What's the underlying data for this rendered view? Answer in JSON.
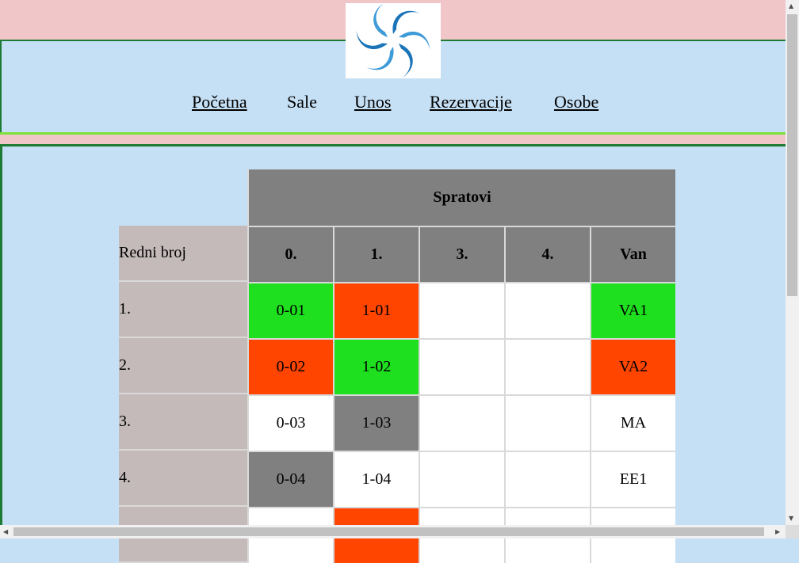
{
  "logo": {
    "icon": "spiral-logo-icon",
    "colors": [
      "#1b74b8",
      "#5ab3e6"
    ]
  },
  "nav": {
    "items": [
      {
        "label": "Početna",
        "link": true
      },
      {
        "label": "Sale",
        "link": false
      },
      {
        "label": "Unos",
        "link": true
      },
      {
        "label": "Rezervacije",
        "link": true
      },
      {
        "label": "Osobe",
        "link": true
      }
    ]
  },
  "table": {
    "group_header": "Spratovi",
    "row_label_header": "Redni broj",
    "columns": [
      "0.",
      "1.",
      "3.",
      "4.",
      "Van"
    ],
    "rows": [
      {
        "number": "1.",
        "cells": [
          {
            "text": "0-01",
            "status": "green"
          },
          {
            "text": "1-01",
            "status": "red"
          },
          {
            "text": "",
            "status": "white"
          },
          {
            "text": "",
            "status": "white"
          },
          {
            "text": "VA1",
            "status": "green"
          }
        ]
      },
      {
        "number": "2.",
        "cells": [
          {
            "text": "0-02",
            "status": "red"
          },
          {
            "text": "1-02",
            "status": "green"
          },
          {
            "text": "",
            "status": "white"
          },
          {
            "text": "",
            "status": "white"
          },
          {
            "text": "VA2",
            "status": "red"
          }
        ]
      },
      {
        "number": "3.",
        "cells": [
          {
            "text": "0-03",
            "status": "white"
          },
          {
            "text": "1-03",
            "status": "gray"
          },
          {
            "text": "",
            "status": "white"
          },
          {
            "text": "",
            "status": "white"
          },
          {
            "text": "MA",
            "status": "white"
          }
        ]
      },
      {
        "number": "4.",
        "cells": [
          {
            "text": "0-04",
            "status": "gray"
          },
          {
            "text": "1-04",
            "status": "white"
          },
          {
            "text": "",
            "status": "white"
          },
          {
            "text": "",
            "status": "white"
          },
          {
            "text": "EE1",
            "status": "white"
          }
        ]
      },
      {
        "number": "",
        "cells": [
          {
            "text": "",
            "status": "white"
          },
          {
            "text": "",
            "status": "red"
          },
          {
            "text": "",
            "status": "white"
          },
          {
            "text": "",
            "status": "white"
          },
          {
            "text": "",
            "status": "white"
          }
        ]
      }
    ]
  },
  "colors": {
    "green": "#1ee01e",
    "red": "#ff4500",
    "gray": "#808080",
    "white": "#ffffff"
  }
}
